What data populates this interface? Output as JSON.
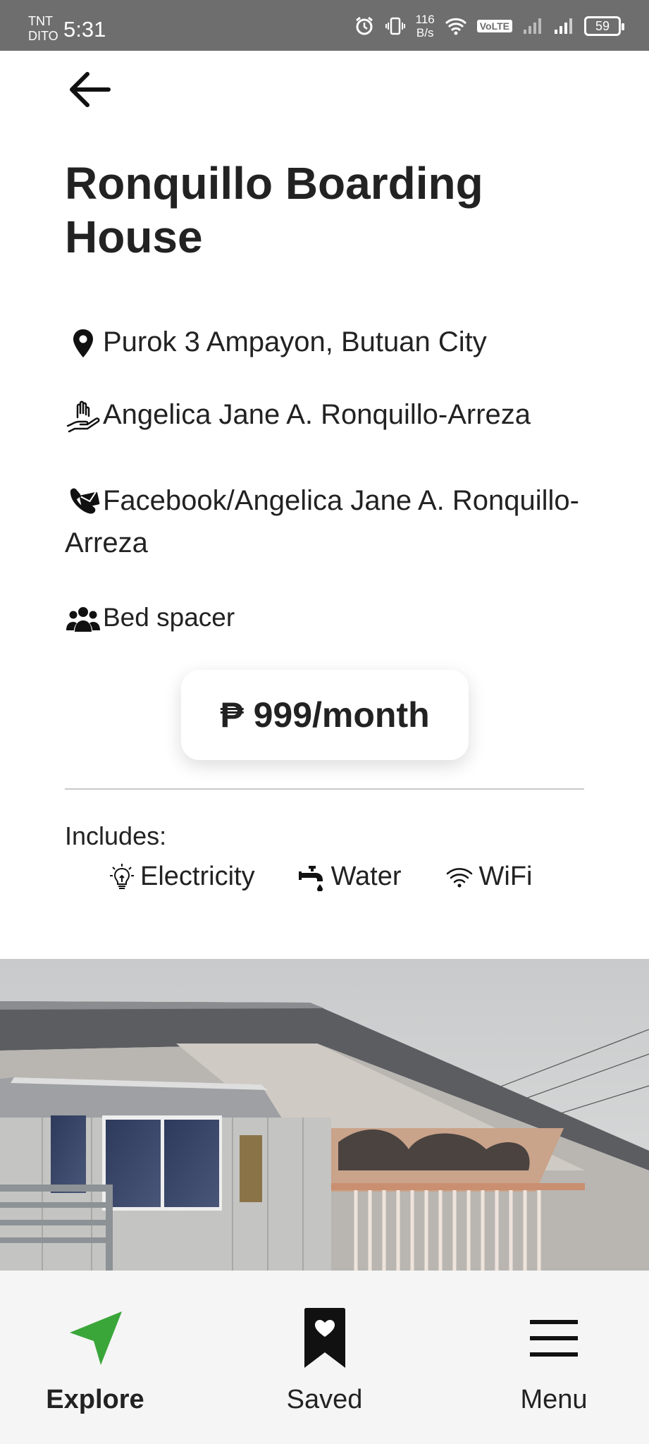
{
  "status_bar": {
    "carrier_top": "TNT",
    "carrier_bottom": "DITO",
    "time": "5:31",
    "net_speed_value": "116",
    "net_speed_unit": "B/s",
    "volte": "VoLTE",
    "battery": "59"
  },
  "listing": {
    "title": "Ronquillo Boarding House",
    "location": "Purok 3 Ampayon, Butuan City",
    "owner": "Angelica Jane A. Ronquillo-Arreza",
    "contact": "Facebook/Angelica Jane A. Ronquillo-Arreza",
    "type": "Bed spacer",
    "price": "₱ 999/month",
    "includes_label": "Includes:",
    "amenities": [
      "Electricity",
      "Water",
      "WiFi"
    ]
  },
  "nav": {
    "explore": "Explore",
    "saved": "Saved",
    "menu": "Menu"
  },
  "colors": {
    "accent_green": "#3aa63a",
    "status_bar": "#6e6e6e",
    "nav_bg": "#f5f5f5"
  },
  "icons": [
    "back-arrow-icon",
    "location-pin-icon",
    "hand-heart-icon",
    "phone-icon",
    "users-icon",
    "lightbulb-icon",
    "faucet-icon",
    "wifi-icon",
    "navigation-arrow-icon",
    "bookmark-heart-icon",
    "hamburger-menu-icon"
  ]
}
